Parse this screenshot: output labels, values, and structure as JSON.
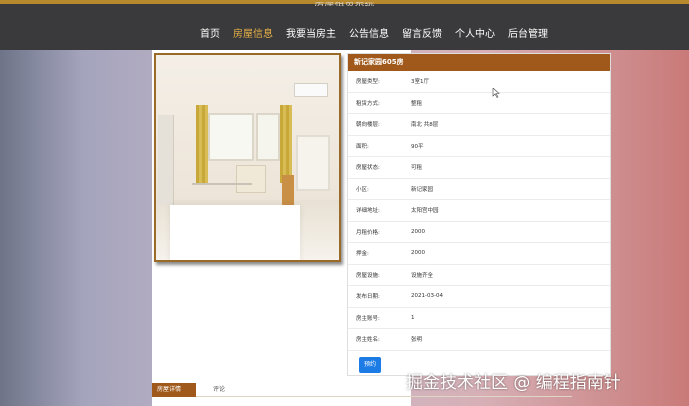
{
  "header": {
    "site_title": "房屋租赁系统",
    "nav": [
      {
        "label": "首页",
        "active": false
      },
      {
        "label": "房屋信息",
        "active": true
      },
      {
        "label": "我要当房主",
        "active": false
      },
      {
        "label": "公告信息",
        "active": false
      },
      {
        "label": "留言反馈",
        "active": false
      },
      {
        "label": "个人中心",
        "active": false
      },
      {
        "label": "后台管理",
        "active": false
      }
    ]
  },
  "house": {
    "title": "新记家园605房",
    "fields": [
      {
        "label": "房屋类型:",
        "value": "3室1厅"
      },
      {
        "label": "租赁方式:",
        "value": "整租"
      },
      {
        "label": "朝向楼层:",
        "value": "南北 共8层"
      },
      {
        "label": "面积:",
        "value": "90平"
      },
      {
        "label": "房屋状态:",
        "value": "可租"
      },
      {
        "label": "小区:",
        "value": "新记家园"
      },
      {
        "label": "详细地址:",
        "value": "太阳宫中园"
      },
      {
        "label": "月租价格:",
        "value": "2000"
      },
      {
        "label": "押金:",
        "value": "2000"
      },
      {
        "label": "房屋设施:",
        "value": "设施齐全"
      },
      {
        "label": "发布日期:",
        "value": "2021-03-04"
      },
      {
        "label": "房主账号:",
        "value": "1"
      },
      {
        "label": "房主姓名:",
        "value": "张明"
      }
    ],
    "book_button": "预约"
  },
  "tabs": [
    {
      "label": "房屋详情",
      "active": true
    },
    {
      "label": "评论",
      "active": false
    }
  ],
  "watermark": "掘金技术社区 @ 编程指南针",
  "colors": {
    "brand": "#a0591b",
    "nav_active": "#e8b246",
    "button": "#1c7be5",
    "topbar": "#3a3a3c"
  }
}
